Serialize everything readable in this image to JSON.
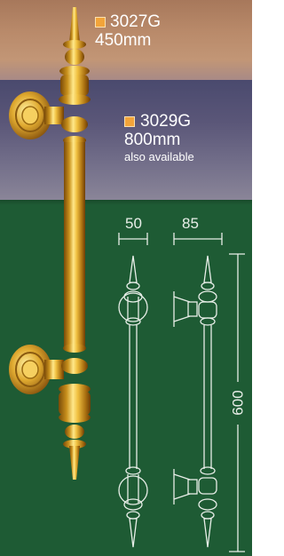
{
  "products": [
    {
      "code": "3027G",
      "size": "450mm",
      "swatch_color": "#f2a43a"
    },
    {
      "code": "3029G",
      "size": "800mm",
      "note": "also available",
      "swatch_color": "#f2a43a"
    }
  ],
  "dimensions": {
    "width_a": "50",
    "width_b": "85",
    "height": "600"
  },
  "colors": {
    "background_green": "#1e5b34",
    "brass": "#d9a62a",
    "drawing_line": "#e8eee8"
  }
}
